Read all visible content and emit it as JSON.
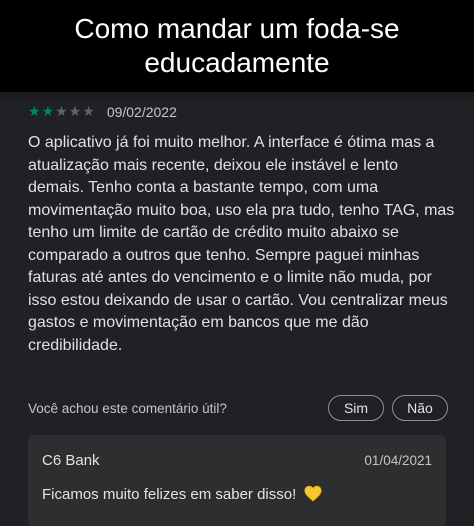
{
  "caption": {
    "text": "Como mandar um foda-se educadamente"
  },
  "review": {
    "rating": 2,
    "rating_max": 5,
    "date": "09/02/2022",
    "body": "O aplicativo já foi muito melhor. A interface é ótima mas a atualização mais recente, deixou ele instável e lento demais. Tenho conta a bastante tempo, com uma movimentação muito boa, uso ela pra tudo, tenho TAG, mas tenho um limite de cartão de crédito muito abaixo se comparado a outros que tenho. Sempre paguei minhas faturas até antes do vencimento e o limite não muda, por isso estou deixando de usar o cartão. Vou centralizar meus gastos e movimentação em bancos que me dão credibilidade."
  },
  "helpful": {
    "question": "Você achou este comentário útil?",
    "yes_label": "Sim",
    "no_label": "Não"
  },
  "developer_reply": {
    "name": "C6 Bank",
    "date": "01/04/2021",
    "text": "Ficamos muito felizes em saber disso!",
    "emoji_icon": "yellow-heart-icon"
  },
  "colors": {
    "star_filled": "#01875f",
    "star_empty": "#5f6368",
    "background": "#202124",
    "reply_background": "#2d2e30",
    "caption_background": "#000000"
  }
}
